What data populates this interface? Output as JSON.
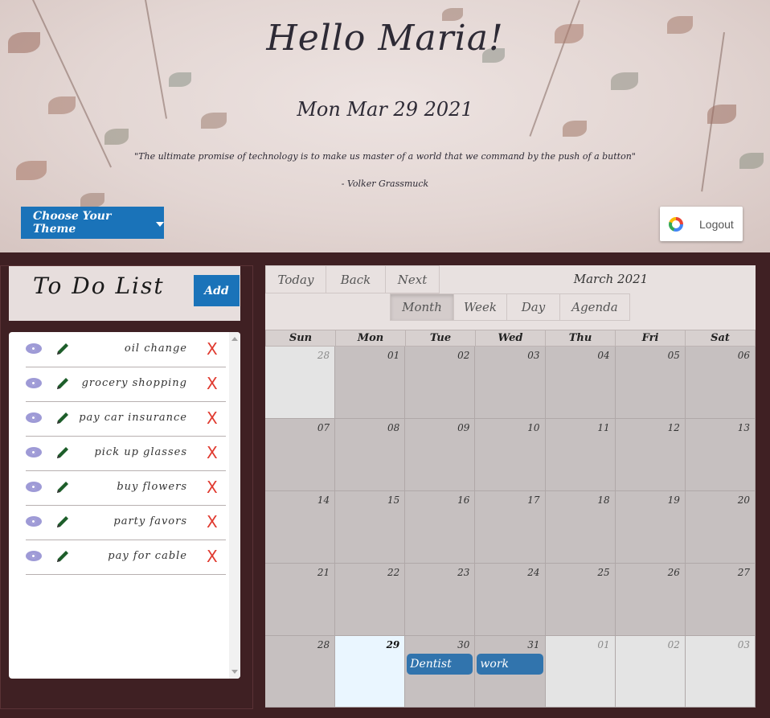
{
  "header": {
    "greeting": "Hello Maria!",
    "date": "Mon Mar 29 2021",
    "quote": "\"The ultimate promise of technology is to make us master of a world that we command by the push of a button\"",
    "author": "- Volker Grassmuck",
    "theme_button": "Choose Your Theme",
    "logout_button": "Logout"
  },
  "todo": {
    "title": "To Do List",
    "add_button": "Add",
    "items": [
      {
        "label": "oil change"
      },
      {
        "label": "grocery shopping"
      },
      {
        "label": "pay car insurance"
      },
      {
        "label": "pick up glasses"
      },
      {
        "label": "buy flowers"
      },
      {
        "label": "party favors"
      },
      {
        "label": "pay for cable"
      }
    ],
    "delete_glyph": "X"
  },
  "calendar": {
    "nav": {
      "today": "Today",
      "back": "Back",
      "next": "Next"
    },
    "label": "March 2021",
    "views": {
      "month": "Month",
      "week": "Week",
      "day": "Day",
      "agenda": "Agenda"
    },
    "active_view": "Month",
    "weekdays": [
      "Sun",
      "Mon",
      "Tue",
      "Wed",
      "Thu",
      "Fri",
      "Sat"
    ],
    "weeks": [
      [
        "28",
        "01",
        "02",
        "03",
        "04",
        "05",
        "06"
      ],
      [
        "07",
        "08",
        "09",
        "10",
        "11",
        "12",
        "13"
      ],
      [
        "14",
        "15",
        "16",
        "17",
        "18",
        "19",
        "20"
      ],
      [
        "21",
        "22",
        "23",
        "24",
        "25",
        "26",
        "27"
      ],
      [
        "28",
        "29",
        "30",
        "31",
        "01",
        "02",
        "03"
      ]
    ],
    "events": [
      {
        "title": "Dentist",
        "day": "30"
      },
      {
        "title": "work",
        "day": "31"
      }
    ],
    "event_color": "#3174ad",
    "accent_color": "#1a73b9"
  }
}
